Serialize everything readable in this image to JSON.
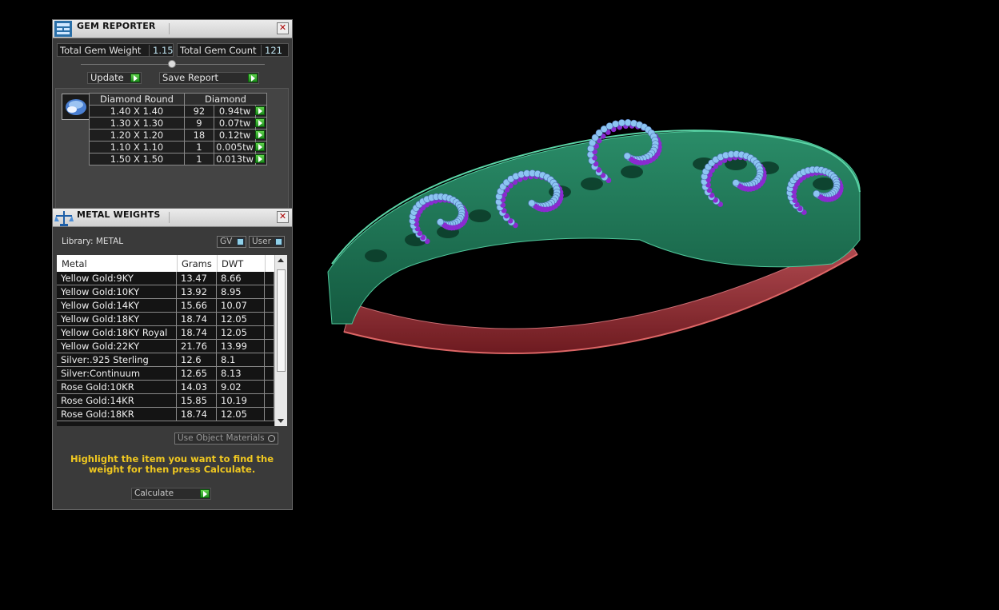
{
  "gem_reporter": {
    "title": "GEM REPORTER",
    "total_gem_weight_label": "Total Gem Weight",
    "total_gem_weight_value": "1.15",
    "total_gem_count_label": "Total Gem Count",
    "total_gem_count_value": "121",
    "update_label": "Update",
    "save_report_label": "Save Report",
    "table": {
      "col_shape": "Diamond Round",
      "col_material": "Diamond",
      "rows": [
        {
          "size": "1.40 X 1.40",
          "count": "92",
          "weight": "0.94tw"
        },
        {
          "size": "1.30 X 1.30",
          "count": "9",
          "weight": "0.07tw"
        },
        {
          "size": "1.20 X 1.20",
          "count": "18",
          "weight": "0.12tw"
        },
        {
          "size": "1.10 X 1.10",
          "count": "1",
          "weight": "0.005tw"
        },
        {
          "size": "1.50 X 1.50",
          "count": "1",
          "weight": "0.013tw"
        }
      ]
    }
  },
  "metal_weights": {
    "title": "METAL WEIGHTS",
    "library_label": "Library: METAL",
    "gv_label": "GV",
    "user_label": "User",
    "columns": {
      "metal": "Metal",
      "grams": "Grams",
      "dwt": "DWT"
    },
    "rows": [
      {
        "metal": "Yellow Gold:9KY",
        "grams": "13.47",
        "dwt": "8.66"
      },
      {
        "metal": "Yellow Gold:10KY",
        "grams": "13.92",
        "dwt": "8.95"
      },
      {
        "metal": "Yellow Gold:14KY",
        "grams": "15.66",
        "dwt": "10.07"
      },
      {
        "metal": "Yellow Gold:18KY",
        "grams": "18.74",
        "dwt": "12.05"
      },
      {
        "metal": "Yellow Gold:18KY Royal",
        "grams": "18.74",
        "dwt": "12.05"
      },
      {
        "metal": "Yellow Gold:22KY",
        "grams": "21.76",
        "dwt": "13.99"
      },
      {
        "metal": "Silver:.925 Sterling",
        "grams": "12.6",
        "dwt": "8.1"
      },
      {
        "metal": "Silver:Continuum",
        "grams": "12.65",
        "dwt": "8.13"
      },
      {
        "metal": "Rose Gold:10KR",
        "grams": "14.03",
        "dwt": "9.02"
      },
      {
        "metal": "Rose Gold:14KR",
        "grams": "15.85",
        "dwt": "10.19"
      },
      {
        "metal": "Rose Gold:18KR",
        "grams": "18.74",
        "dwt": "12.05"
      }
    ],
    "use_object_materials_label": "Use Object Materials",
    "hint_text": "Highlight the item you want to find the weight for then press Calculate.",
    "calculate_label": "Calculate"
  },
  "colors": {
    "band_green": "#1f7a5a",
    "gem_light_blue": "#8cc4f2",
    "gem_purple": "#8a2bd0",
    "inner_band_red": "#b0363c",
    "hint_yellow": "#f0c820"
  }
}
